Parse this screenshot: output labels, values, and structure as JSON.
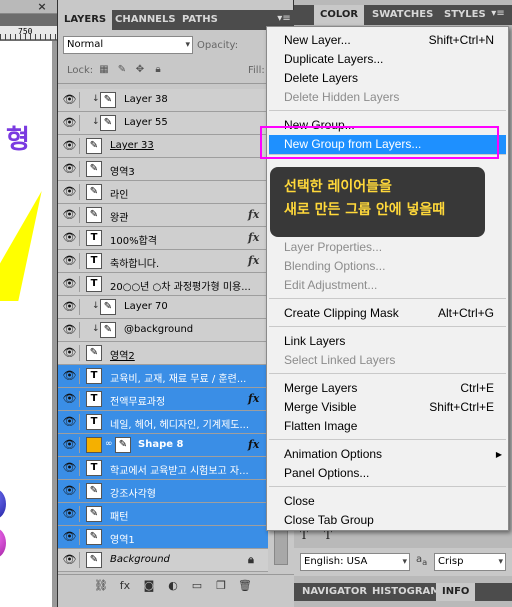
{
  "canvas": {
    "close_glyph": "×",
    "ruler_value": "750",
    "doc_text": "형"
  },
  "layers_panel": {
    "tabs": [
      "LAYERS",
      "CHANNELS",
      "PATHS"
    ],
    "blend_mode": "Normal",
    "opacity_label": "Opacity:",
    "lock_label": "Lock:",
    "fill_label": "Fill:",
    "layers": [
      {
        "name": "Layer 38",
        "type": "brush",
        "clipped": true,
        "fx": false,
        "selected": false
      },
      {
        "name": "Layer 55",
        "type": "brush",
        "clipped": true,
        "fx": false,
        "selected": false
      },
      {
        "name": "Layer 33",
        "type": "brush",
        "clipped": false,
        "fx": false,
        "selected": false
      },
      {
        "name": "영역3",
        "type": "brush",
        "clipped": false,
        "fx": false,
        "selected": false
      },
      {
        "name": "라인",
        "type": "brush",
        "clipped": false,
        "fx": false,
        "selected": false
      },
      {
        "name": "왕관",
        "type": "brush",
        "clipped": false,
        "fx": true,
        "selected": false
      },
      {
        "name": "100%합격",
        "type": "text",
        "clipped": false,
        "fx": true,
        "selected": false
      },
      {
        "name": "축하합니다.",
        "type": "text",
        "clipped": false,
        "fx": true,
        "selected": false
      },
      {
        "name": "20○○년 ○차 과정평가형 미용...",
        "type": "text",
        "clipped": false,
        "fx": false,
        "selected": false
      },
      {
        "name": "Layer 70",
        "type": "brush",
        "clipped": true,
        "fx": false,
        "selected": false
      },
      {
        "name": "@background",
        "type": "brush",
        "clipped": true,
        "fx": false,
        "selected": false
      },
      {
        "name": "영역2",
        "type": "brush",
        "clipped": false,
        "fx": false,
        "selected": false
      },
      {
        "name": "교육비, 교재, 재료 무료 / 훈련...",
        "type": "text",
        "clipped": false,
        "fx": false,
        "selected": true
      },
      {
        "name": "전액무료과정",
        "type": "text",
        "clipped": false,
        "fx": true,
        "selected": true
      },
      {
        "name": "네일, 헤어, 헤디자인, 기계제도...",
        "type": "text",
        "clipped": false,
        "fx": false,
        "selected": true
      },
      {
        "name": "Shape 8",
        "type": "shape",
        "clipped": false,
        "fx": true,
        "selected": true
      },
      {
        "name": "학교에서 교육받고 시험보고 자...",
        "type": "text",
        "clipped": false,
        "fx": false,
        "selected": true
      },
      {
        "name": "강조사각형",
        "type": "brush",
        "clipped": false,
        "fx": false,
        "selected": true
      },
      {
        "name": "패턴",
        "type": "brush",
        "clipped": false,
        "fx": false,
        "selected": true
      },
      {
        "name": "영역1",
        "type": "brush",
        "clipped": false,
        "fx": false,
        "selected": true
      },
      {
        "name": "Background",
        "type": "brush",
        "clipped": false,
        "fx": false,
        "selected": false,
        "locked": true
      }
    ],
    "fx_glyph": "fx"
  },
  "color_panel": {
    "tabs": [
      "COLOR",
      "SWATCHES",
      "STYLES"
    ],
    "language": "English: USA",
    "aa_label": "a",
    "antialias": "Crisp",
    "bottom_tabs": [
      "NAVIGATOR",
      "HISTOGRAM",
      "INFO"
    ],
    "char_glyphs": "T T"
  },
  "context_menu": {
    "items": [
      {
        "label": "New Layer...",
        "shortcut": "Shift+Ctrl+N",
        "disabled": false
      },
      {
        "label": "Duplicate Layers...",
        "shortcut": "",
        "disabled": false
      },
      {
        "label": "Delete Layers",
        "shortcut": "",
        "disabled": false
      },
      {
        "label": "Delete Hidden Layers",
        "shortcut": "",
        "disabled": true
      },
      {
        "label": "New Group...",
        "shortcut": "",
        "disabled": false
      },
      {
        "label": "New Group from Layers...",
        "shortcut": "",
        "disabled": false,
        "highlighted": true
      },
      {
        "label": "Layer Properties...",
        "shortcut": "",
        "disabled": true
      },
      {
        "label": "Blending Options...",
        "shortcut": "",
        "disabled": true
      },
      {
        "label": "Edit Adjustment...",
        "shortcut": "",
        "disabled": true
      },
      {
        "label": "Create Clipping Mask",
        "shortcut": "Alt+Ctrl+G",
        "disabled": false
      },
      {
        "label": "Link Layers",
        "shortcut": "",
        "disabled": false
      },
      {
        "label": "Select Linked Layers",
        "shortcut": "",
        "disabled": true
      },
      {
        "label": "Merge Layers",
        "shortcut": "Ctrl+E",
        "disabled": false
      },
      {
        "label": "Merge Visible",
        "shortcut": "Shift+Ctrl+E",
        "disabled": false
      },
      {
        "label": "Flatten Image",
        "shortcut": "",
        "disabled": false
      },
      {
        "label": "Animation Options",
        "shortcut": "",
        "disabled": false,
        "submenu": true
      },
      {
        "label": "Panel Options...",
        "shortcut": "",
        "disabled": false
      },
      {
        "label": "Close",
        "shortcut": "",
        "disabled": false
      },
      {
        "label": "Close Tab Group",
        "shortcut": "",
        "disabled": false
      }
    ]
  },
  "tooltip": {
    "line1": "선택한 레이어들을",
    "line2": "새로 만든 그룹 안에 넣을때"
  },
  "colors": {
    "selection_blue": "#3a8ee6",
    "menu_highlight": "#1e90ff",
    "callout_border": "#ff00ff",
    "tooltip_text": "#ffd83a"
  }
}
